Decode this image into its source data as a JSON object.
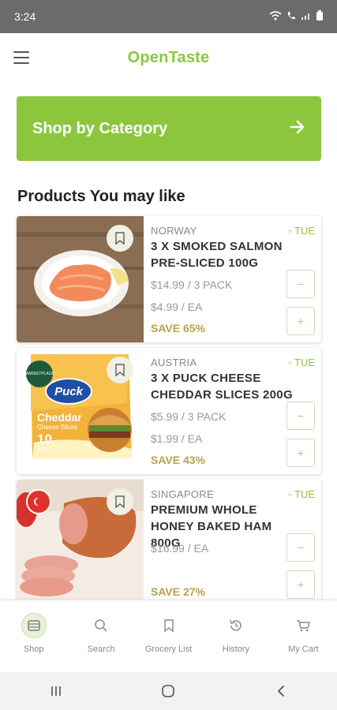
{
  "status_bar": {
    "time": "3:24"
  },
  "app_bar": {
    "title": "OpenTaste"
  },
  "category_button": {
    "label": "Shop by Category"
  },
  "section": {
    "title": "Products You may like"
  },
  "products": [
    {
      "country": "NORWAY",
      "day": "TUE",
      "name": "3 X SMOKED SALMON PRE-SLICED 100G",
      "price_pack": "$14.99 / 3 PACK",
      "price_each": "$4.99 / EA",
      "save": "SAVE 65%"
    },
    {
      "country": "AUSTRIA",
      "day": "TUE",
      "name": "3 X PUCK CHEESE CHEDDAR SLICES 200G",
      "price_pack": "$5.99 / 3 PACK",
      "price_each": "$1.99 / EA",
      "save": "SAVE 43%",
      "image_text": {
        "badge": "MARKETPLACE",
        "brand": "Puck",
        "product": "Cheddar",
        "sub": "Cheese Slices",
        "count": "10",
        "count_label": "SLICES"
      }
    },
    {
      "country": "SINGAPORE",
      "day": "TUE",
      "name": "PREMIUM WHOLE HONEY BAKED HAM 800G",
      "price_each": "$16.99 /  EA",
      "save": "SAVE 27%"
    }
  ],
  "bottom_nav": [
    {
      "label": "Shop",
      "icon": "shop-icon",
      "active": true
    },
    {
      "label": "Search",
      "icon": "search-icon"
    },
    {
      "label": "Grocery List",
      "icon": "bookmark-icon"
    },
    {
      "label": "History",
      "icon": "history-icon"
    },
    {
      "label": "My Cart",
      "icon": "cart-icon"
    }
  ],
  "colors": {
    "brand": "#8cc63f",
    "save": "#b8a050",
    "status_bar": "#6b6b6b"
  }
}
